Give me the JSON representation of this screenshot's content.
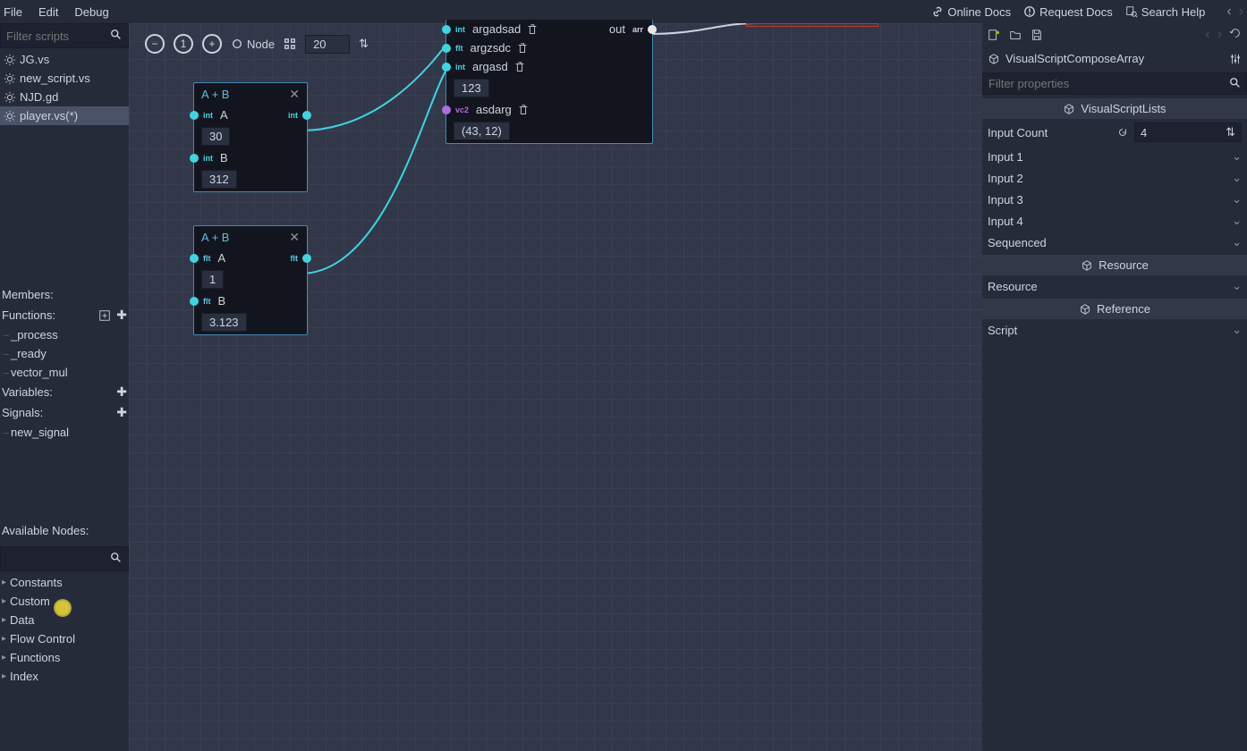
{
  "menu": {
    "file": "File",
    "edit": "Edit",
    "debug": "Debug",
    "online_docs": "Online Docs",
    "request_docs": "Request Docs",
    "search_help": "Search Help"
  },
  "left": {
    "filter_placeholder": "Filter scripts",
    "scripts": [
      {
        "name": "JG.vs"
      },
      {
        "name": "new_script.vs"
      },
      {
        "name": "NJD.gd"
      },
      {
        "name": "player.vs(*)"
      }
    ],
    "members_label": "Members:",
    "functions_label": "Functions:",
    "functions": [
      "_process",
      "_ready",
      "vector_mul"
    ],
    "variables_label": "Variables:",
    "signals_label": "Signals:",
    "signals": [
      "new_signal"
    ],
    "available_label": "Available Nodes:",
    "node_cats": [
      "Constants",
      "Custom",
      "Data",
      "Flow Control",
      "Functions",
      "Index"
    ]
  },
  "toolbar": {
    "node": "Node",
    "zoom": "20"
  },
  "nodes": {
    "n1": {
      "title": "A + B",
      "a_label": "A",
      "a_val": "30",
      "b_label": "B",
      "b_val": "312"
    },
    "n2": {
      "title": "A + B",
      "a_label": "A",
      "a_val": "1",
      "b_label": "B",
      "b_val": "3.123"
    },
    "compose": {
      "p1": "argadsad",
      "out": "out",
      "p2": "argzsdc",
      "p3": "argasd",
      "p3_val": "123",
      "p4": "asdarg",
      "p4_val": "(43, 12)"
    }
  },
  "inspector": {
    "title": "VisualScriptComposeArray",
    "filter_placeholder": "Filter properties",
    "sections": {
      "lists": "VisualScriptLists",
      "resource": "Resource",
      "reference": "Reference"
    },
    "input_count_label": "Input Count",
    "input_count_val": "4",
    "inputs": [
      "Input 1",
      "Input 2",
      "Input 3",
      "Input 4"
    ],
    "sequenced": "Sequenced",
    "resource_label": "Resource",
    "script_label": "Script"
  }
}
